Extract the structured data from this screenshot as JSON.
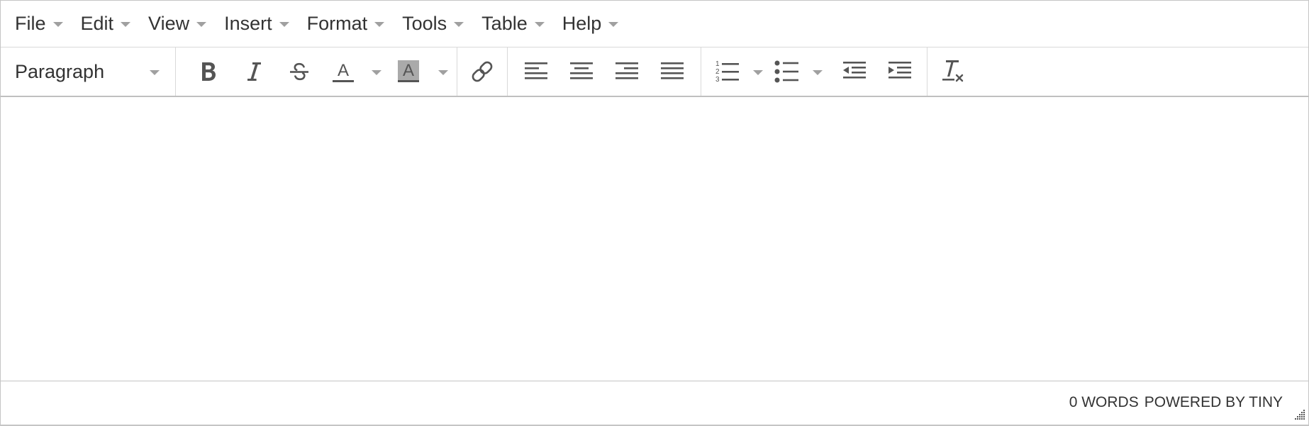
{
  "menubar": {
    "items": [
      {
        "label": "File"
      },
      {
        "label": "Edit"
      },
      {
        "label": "View"
      },
      {
        "label": "Insert"
      },
      {
        "label": "Format"
      },
      {
        "label": "Tools"
      },
      {
        "label": "Table"
      },
      {
        "label": "Help"
      }
    ]
  },
  "toolbar": {
    "block_format": "Paragraph",
    "buttons": [
      {
        "icon": "bold-icon"
      },
      {
        "icon": "italic-icon"
      },
      {
        "icon": "strikethrough-icon"
      },
      {
        "icon": "text-color-icon"
      },
      {
        "icon": "background-color-icon"
      },
      {
        "icon": "link-icon"
      },
      {
        "icon": "align-left-icon"
      },
      {
        "icon": "align-center-icon"
      },
      {
        "icon": "align-right-icon"
      },
      {
        "icon": "align-justify-icon"
      },
      {
        "icon": "numbered-list-icon"
      },
      {
        "icon": "bullet-list-icon"
      },
      {
        "icon": "outdent-icon"
      },
      {
        "icon": "indent-icon"
      },
      {
        "icon": "clear-formatting-icon"
      }
    ],
    "text_color_letter": "A",
    "background_color_letter": "A"
  },
  "statusbar": {
    "word_count": "0 WORDS",
    "branding": "POWERED BY TINY"
  },
  "colors": {
    "icon": "#555555",
    "text": "#333333",
    "caret": "#a0a0a0",
    "border": "#c5c5c5",
    "highlight_swatch": "#aaaaaa"
  }
}
